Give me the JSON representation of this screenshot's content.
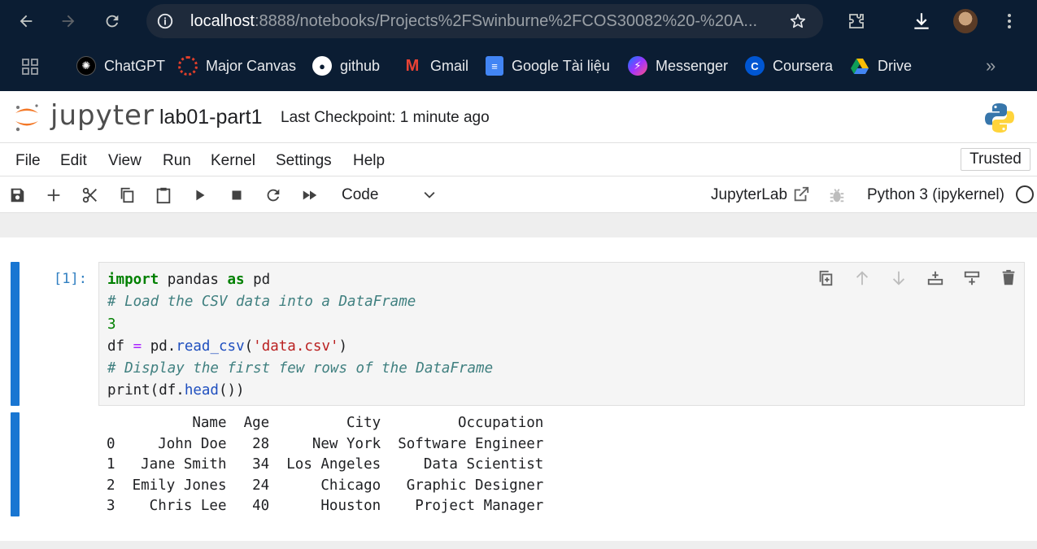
{
  "browser": {
    "url_host": "localhost",
    "url_path": ":8888/notebooks/Projects%2FSwinburne%2FCOS30082%20-%20A...",
    "bookmarks": [
      {
        "label": "ChatGPT",
        "icon": "chatgpt-icon"
      },
      {
        "label": "Major Canvas",
        "icon": "canvas-icon"
      },
      {
        "label": "github",
        "icon": "github-icon"
      },
      {
        "label": "Gmail",
        "icon": "gmail-icon"
      },
      {
        "label": "Google Tài liệu",
        "icon": "google-docs-icon"
      },
      {
        "label": "Messenger",
        "icon": "messenger-icon"
      },
      {
        "label": "Coursera",
        "icon": "coursera-icon"
      },
      {
        "label": "Drive",
        "icon": "drive-icon"
      }
    ],
    "bookmarks_overflow": "»"
  },
  "jupyter": {
    "brand": "jupyter",
    "notebook_name": "lab01-part1",
    "checkpoint": "Last Checkpoint: 1 minute ago",
    "menu": [
      "File",
      "Edit",
      "View",
      "Run",
      "Kernel",
      "Settings",
      "Help"
    ],
    "trusted": "Trusted",
    "cell_type": "Code",
    "jupyterlab_link": "JupyterLab",
    "kernel_name": "Python 3 (ipykernel)"
  },
  "cell": {
    "prompt": "[1]:",
    "code": [
      {
        "tokens": [
          [
            "kw",
            "import"
          ],
          [
            "t",
            " pandas "
          ],
          [
            "kw",
            "as"
          ],
          [
            "t",
            " pd"
          ]
        ]
      },
      {
        "tokens": [
          [
            "cm",
            "# Load the CSV data into a DataFrame"
          ]
        ]
      },
      {
        "tokens": [
          [
            "nm",
            "3"
          ]
        ]
      },
      {
        "tokens": [
          [
            "t",
            "df "
          ],
          [
            "op",
            "="
          ],
          [
            "t",
            " pd."
          ],
          [
            "fn",
            "read_csv"
          ],
          [
            "t",
            "("
          ],
          [
            "st",
            "'data.csv'"
          ],
          [
            "t",
            ")"
          ]
        ]
      },
      {
        "tokens": [
          [
            "cm",
            "# Display the first few rows of the DataFrame"
          ]
        ]
      },
      {
        "tokens": [
          [
            "t",
            "print(df."
          ],
          [
            "fn",
            "head"
          ],
          [
            "t",
            "())"
          ]
        ]
      }
    ],
    "output": [
      "          Name  Age         City         Occupation",
      "0     John Doe   28     New York  Software Engineer",
      "1   Jane Smith   34  Los Angeles     Data Scientist",
      "2  Emily Jones   24      Chicago   Graphic Designer",
      "3    Chris Lee   40      Houston    Project Manager"
    ]
  },
  "colors": {
    "chrome_bg": "#0b1d33",
    "selection_bar": "#1976d2",
    "jupyter_orange": "#f37726"
  }
}
